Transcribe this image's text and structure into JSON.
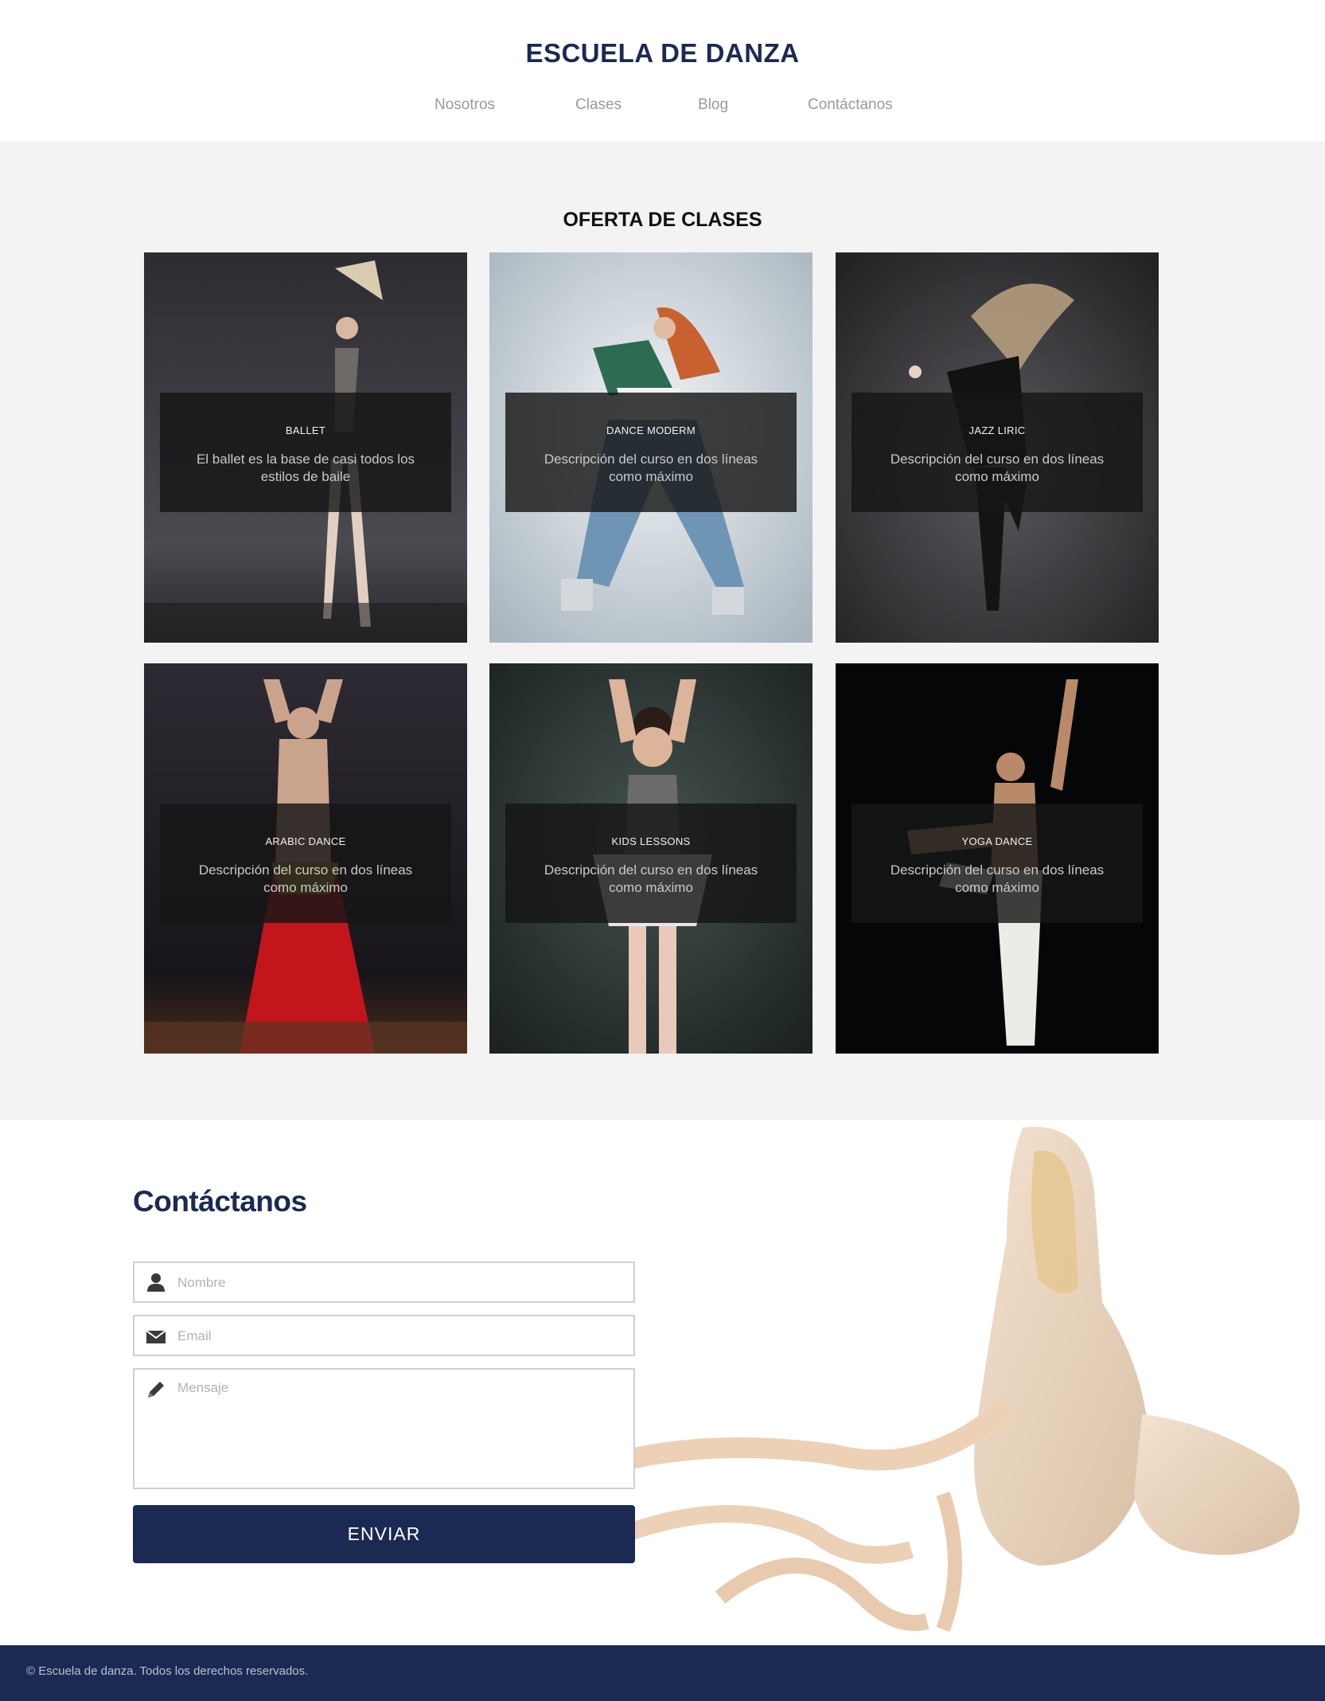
{
  "site": {
    "title": "ESCUELA DE DANZA"
  },
  "nav": {
    "items": [
      "Nosotros",
      "Clases",
      "Blog",
      "Contáctanos"
    ]
  },
  "classes": {
    "title": "OFERTA DE CLASES",
    "cards": [
      {
        "title": "BALLET",
        "description": "El ballet es la base de casi todos los estilos de baile"
      },
      {
        "title": "DANCE MODERM",
        "description": "Descripción del curso en dos líneas como máximo"
      },
      {
        "title": "JAZZ LIRIC",
        "description": "Descripción del curso en dos líneas como máximo"
      },
      {
        "title": "ARABIC DANCE",
        "description": "Descripción del curso en dos líneas como máximo"
      },
      {
        "title": "KIDS LESSONS",
        "description": "Descripción del curso en dos líneas como máximo"
      },
      {
        "title": "YOGA DANCE",
        "description": "Descripción del curso en dos líneas como máximo"
      }
    ]
  },
  "contact": {
    "title": "Contáctanos",
    "name_placeholder": "Nombre",
    "email_placeholder": "Email",
    "message_placeholder": "Mensaje",
    "send_label": "ENVIAR"
  },
  "footer": {
    "text": "© Escuela de danza. Todos los derechos reservados."
  },
  "colors": {
    "brand": "#1b2a52",
    "section_bg": "#f3f3f3",
    "nav_text": "#9a9a9a"
  },
  "icons": [
    "user-icon",
    "envelope-icon",
    "pencil-icon"
  ]
}
